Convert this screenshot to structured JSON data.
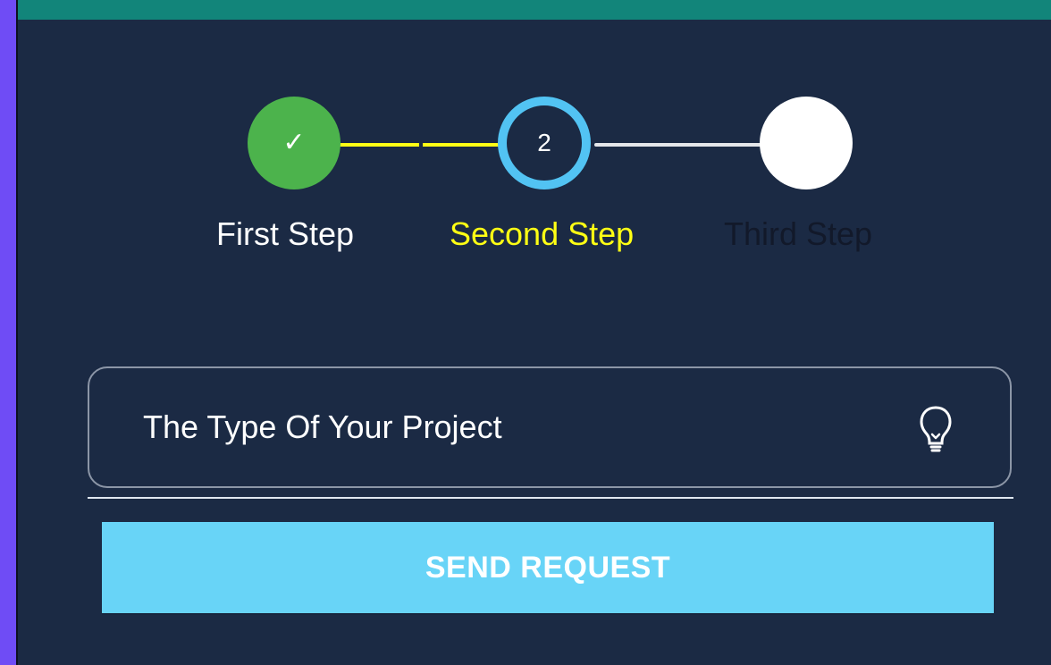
{
  "steps": [
    {
      "label": "First Step",
      "state": "done",
      "icon": "check-icon"
    },
    {
      "label": "Second Step",
      "state": "active",
      "number": "2"
    },
    {
      "label": "Third Step",
      "state": "pending"
    }
  ],
  "form": {
    "project_type_placeholder": "The Type Of Your Project",
    "field_icon": "lightbulb-icon"
  },
  "actions": {
    "send_label": "SEND REQUEST"
  },
  "colors": {
    "outer_background": "#6f4cf5",
    "top_bar": "#12857a",
    "panel_background": "#1b2a44",
    "done_step": "#4cb34c",
    "active_step": "#52c3f3",
    "active_label": "#ffff14",
    "button_background": "#68d4f7"
  }
}
